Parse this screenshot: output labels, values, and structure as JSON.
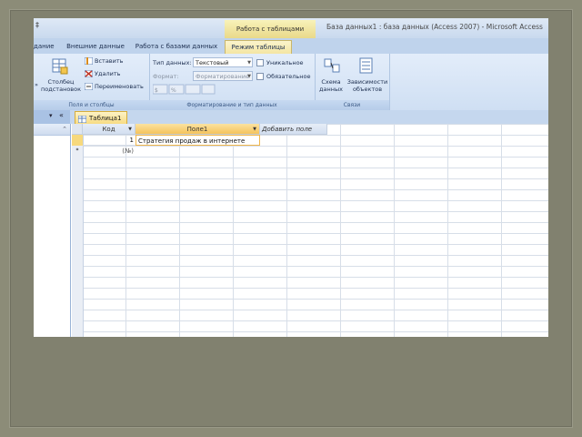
{
  "window": {
    "title": "База данных1 : база данных (Access 2007) - Microsoft Access",
    "contextual_tab": "Работа с таблицами",
    "quick_access_glyph": "‡"
  },
  "ribbon_tabs": [
    {
      "label": "дание",
      "active": false
    },
    {
      "label": "Внешние данные",
      "active": false
    },
    {
      "label": "Работа с базами данных",
      "active": false
    },
    {
      "label": "Режим таблицы",
      "active": true
    }
  ],
  "ribbon": {
    "fields_group": {
      "label": "Поля и столбцы",
      "lookup_column": "Столбец подстановок",
      "insert": "Вставить",
      "delete": "Удалить",
      "rename": "Переименовать",
      "left_cut": "»"
    },
    "format_group": {
      "label": "Форматирование и тип данных",
      "data_type_label": "Тип данных:",
      "data_type_value": "Текстовый",
      "format_label": "Формат:",
      "format_value": "Форматирование",
      "unique": "Уникальное",
      "required": "Обязательное"
    },
    "relations_group": {
      "label": "Связи",
      "schema": "Схема данных",
      "dependencies": "Зависимости объектов"
    }
  },
  "navigation": {
    "pane_dropdown": "▾",
    "pane_collapse": "«",
    "pane_sort": "⌃",
    "document_tab": "Таблица1"
  },
  "table": {
    "columns": [
      "Код",
      "Поле1",
      "Добавить поле"
    ],
    "rows": [
      {
        "selector": "",
        "cells": [
          "1",
          "Стратегия продаж в интернете",
          ""
        ]
      },
      {
        "selector": "*",
        "cells": [
          "(№)",
          "",
          ""
        ]
      }
    ]
  },
  "colors": {
    "accent_orange": "#f7d97d",
    "ribbon_blue": "#cfdff3",
    "slide_background": "#81816f"
  }
}
